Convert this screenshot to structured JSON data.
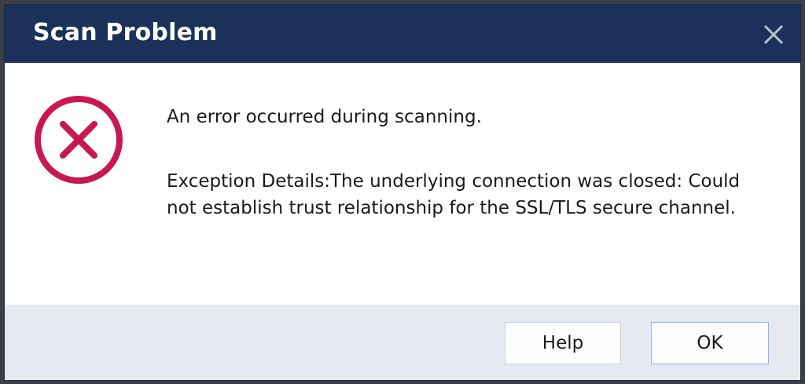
{
  "dialog": {
    "title": "Scan Problem",
    "close_icon": "close-icon",
    "error_icon": "error-circle-x-icon",
    "message": "An error occurred during scanning.",
    "details": "Exception Details:The underlying connection was closed: Could not establish trust relationship for the SSL/TLS secure channel.",
    "buttons": {
      "help_label": "Help",
      "ok_label": "OK"
    }
  },
  "colors": {
    "titlebar": "#1b3159",
    "error_accent": "#c8194f",
    "footer_bg": "#e6e9ef"
  }
}
